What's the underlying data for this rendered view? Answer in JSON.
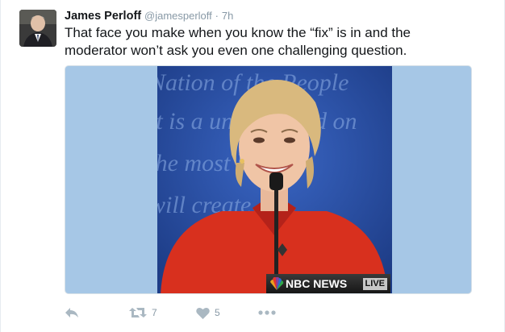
{
  "tweet": {
    "name": "James Perloff",
    "handle": "@jamesperloff",
    "separator": "·",
    "time": "7h",
    "text": "That face you make when you know the “fix” is in and the moderator won’t ask you even one challenging question."
  },
  "media": {
    "backdrop_text": [
      "Nation of the People",
      "it is a union based on",
      "she most like",
      "will create"
    ],
    "broadcast_bug": "NBC NEWS",
    "live_badge": "LIVE"
  },
  "actions": {
    "reply_icon": "reply-icon",
    "retweet_icon": "retweet-icon",
    "retweet_count": "7",
    "like_icon": "heart-icon",
    "like_count": "5",
    "more_icon": "more-icon"
  },
  "colors": {
    "name": "#14171a",
    "meta": "#8899a6",
    "action_icon": "#aab8c2",
    "media_bg": "#a6c7e6",
    "stage_blue": "#2c52a7",
    "jacket_red": "#d8301e"
  }
}
